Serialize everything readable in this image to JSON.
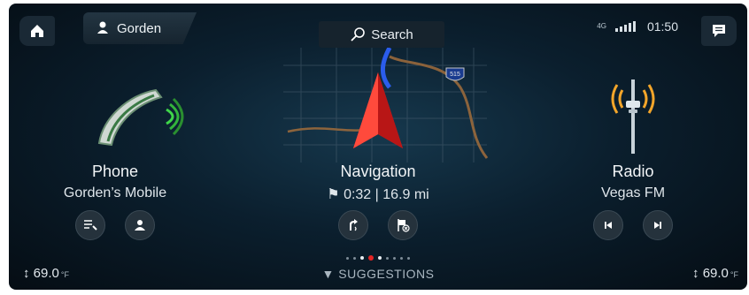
{
  "topbar": {
    "profile_name": "Gorden",
    "search_label": "Search",
    "network_label": "4G",
    "time": "01:50"
  },
  "map": {
    "highway_shield": "515"
  },
  "phone": {
    "title": "Phone",
    "subtitle": "Gorden’s Mobile"
  },
  "navigation": {
    "title": "Navigation",
    "eta": "0:32",
    "separator": "|",
    "distance": "16.9 mi"
  },
  "radio": {
    "title": "Radio",
    "station": "Vegas FM"
  },
  "climate": {
    "left_temp": "69.0",
    "right_temp": "69.0",
    "unit": "°F"
  },
  "pager": {
    "count": 9,
    "active_index": 3
  },
  "suggestions_label": "SUGGESTIONS",
  "colors": {
    "accent_red": "#e32424",
    "phone_green": "#3fd64a",
    "radio_amber": "#f2a52a"
  },
  "icons": [
    "home-icon",
    "person-icon",
    "search-icon",
    "network-icon",
    "signal-icon",
    "message-icon",
    "phone-handset-icon",
    "nav-arrow-icon",
    "radio-tower-icon",
    "call-list-icon",
    "contacts-icon",
    "voice-guidance-icon",
    "cancel-route-icon",
    "previous-track-icon",
    "next-track-icon",
    "updown-arrows-icon",
    "chevron-down-icon"
  ]
}
